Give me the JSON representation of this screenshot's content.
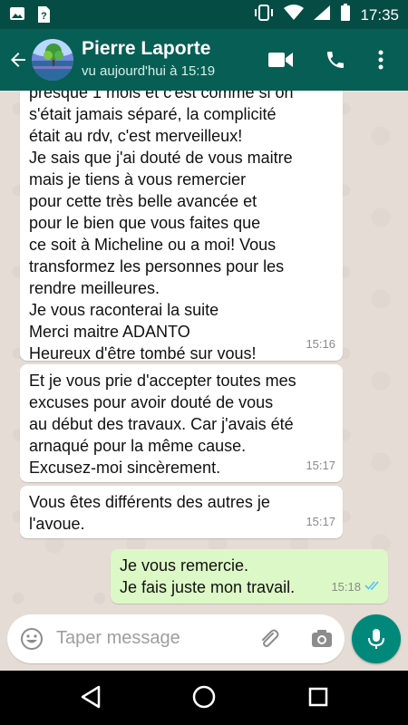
{
  "status_bar": {
    "time": "17:35",
    "icons": [
      "image-icon",
      "unknown-icon",
      "vibrate-icon",
      "wifi-icon",
      "signal-icon",
      "battery-icon"
    ]
  },
  "header": {
    "contact_name": "Pierre Laporte",
    "last_seen": "vu aujourd'hui à 15:19",
    "icons": [
      "back-arrow-icon",
      "video-call-icon",
      "phone-icon",
      "more-options-icon"
    ]
  },
  "messages": [
    {
      "direction": "incoming",
      "lines": [
        "presque 1 mois et c'est comme si on",
        "s'était jamais séparé, la complicité",
        "était au rdv, c'est merveilleux!",
        "Je sais que j'ai douté de vous maitre",
        "mais je tiens à vous remercier",
        "pour cette très belle avancée et",
        "pour le bien que vous faites que",
        "ce soit à Micheline ou a moi! Vous",
        "transformez les personnes pour les",
        "rendre meilleures.",
        "Je vous raconterai la suite",
        "Merci maitre ADANTO",
        "Heureux d'être tombé sur vous!"
      ],
      "time": "15:16"
    },
    {
      "direction": "incoming",
      "lines": [
        "Et je vous prie d'accepter toutes mes",
        "excuses pour avoir douté de vous",
        "au début des travaux. Car j'avais été",
        "arnaqué pour la même cause.",
        "Excusez-moi sincèrement."
      ],
      "time": "15:17"
    },
    {
      "direction": "incoming",
      "lines": [
        "Vous êtes différents des autres je",
        "l'avoue."
      ],
      "time": "15:17"
    },
    {
      "direction": "outgoing",
      "lines": [
        "Je vous remercie.",
        "Je fais juste mon travail."
      ],
      "time": "15:18",
      "read_receipt": "double-check-icon"
    }
  ],
  "input": {
    "placeholder": "Taper message",
    "icons": [
      "emoji-icon",
      "attach-icon",
      "camera-icon",
      "mic-icon"
    ]
  },
  "nav_bar": {
    "icons": [
      "nav-back-icon",
      "nav-home-icon",
      "nav-recents-icon"
    ]
  },
  "colors": {
    "status_bar": "#054d44",
    "app_bar": "#075e54",
    "chat_background": "#e5ddd5",
    "incoming_bubble": "#ffffff",
    "outgoing_bubble": "#dcf8c6",
    "read_receipt": "#4fc3f7",
    "mic_button": "#00897b"
  }
}
